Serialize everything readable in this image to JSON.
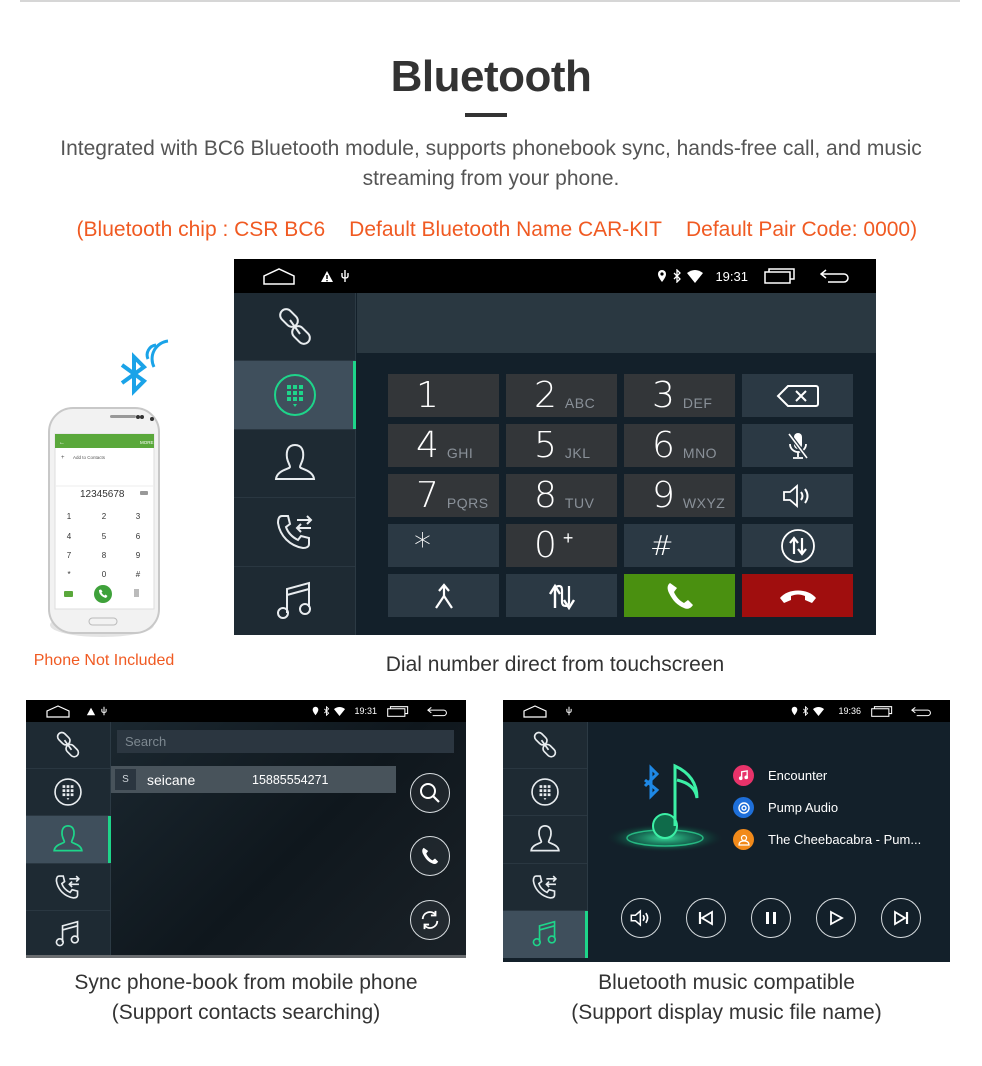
{
  "header": {
    "title": "Bluetooth",
    "intro": "Integrated with BC6 Bluetooth module, supports phonebook sync, hands-free call, and music streaming from your phone.",
    "specs": [
      "(Bluetooth chip : CSR BC6",
      "Default Bluetooth Name CAR-KIT",
      "Default Pair Code: 0000)"
    ]
  },
  "colors": {
    "accent_green": "#1ed58a",
    "spec_orange": "#f05a22",
    "call_green": "#4a9010",
    "hangup_red": "#a00e0e",
    "bluetooth_blue": "#1aa3e8"
  },
  "phone_illustration": {
    "caption": "Phone Not Included",
    "add_to_contacts": "Add to Contacts",
    "more": "MORE",
    "number": "12345678",
    "keys": [
      "1",
      "2",
      "3",
      "4",
      "5",
      "6",
      "7",
      "8",
      "9",
      "*",
      "0",
      "#"
    ]
  },
  "dialer_screen": {
    "status": {
      "time": "19:31"
    },
    "sidebar": [
      {
        "icon": "link-icon",
        "active": false
      },
      {
        "icon": "dialpad-icon",
        "active": true
      },
      {
        "icon": "contact-icon",
        "active": false
      },
      {
        "icon": "call-log-icon",
        "active": false
      },
      {
        "icon": "music-icon",
        "active": false
      }
    ],
    "keys": [
      {
        "num": "1",
        "letters": ""
      },
      {
        "num": "2",
        "letters": "ABC"
      },
      {
        "num": "3",
        "letters": "DEF"
      },
      {
        "num": "4",
        "letters": "GHI"
      },
      {
        "num": "5",
        "letters": "JKL"
      },
      {
        "num": "6",
        "letters": "MNO"
      },
      {
        "num": "7",
        "letters": "PQRS"
      },
      {
        "num": "8",
        "letters": "TUV"
      },
      {
        "num": "9",
        "letters": "WXYZ"
      },
      {
        "num": "*",
        "letters": ""
      },
      {
        "num": "0",
        "letters": "+"
      },
      {
        "num": "#",
        "letters": ""
      }
    ],
    "caption": "Dial number direct from touchscreen"
  },
  "contacts_screen": {
    "status": {
      "time": "19:31"
    },
    "search_placeholder": "Search",
    "contacts": [
      {
        "letter": "S",
        "name": "seicane",
        "phone": "15885554271"
      }
    ],
    "caption_line1": "Sync phone-book from mobile phone",
    "caption_line2": "(Support contacts searching)"
  },
  "music_screen": {
    "status": {
      "time": "19:36"
    },
    "tracks": [
      {
        "label": "Encounter",
        "icon": "music-note-icon",
        "color": "#e8336a"
      },
      {
        "label": "Pump Audio",
        "icon": "album-icon",
        "color": "#1e6fd9"
      },
      {
        "label": "The Cheebacabra - Pum...",
        "icon": "artist-icon",
        "color": "#f28a1a"
      }
    ],
    "caption_line1": "Bluetooth music compatible",
    "caption_line2": "(Support display music file name)"
  }
}
